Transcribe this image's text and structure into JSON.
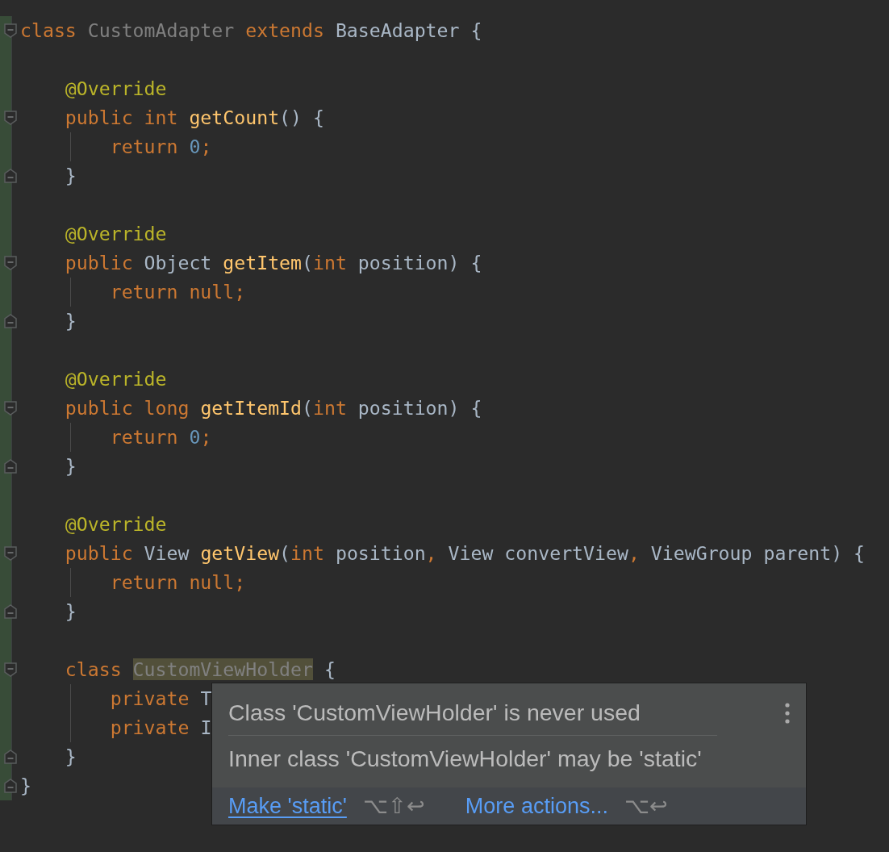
{
  "editor": {
    "lines": [
      {
        "kind": "code",
        "changed": true,
        "fold_start": true,
        "fold_end": false,
        "guide": false,
        "tokens": [
          {
            "kind": "keyword",
            "text": "class "
          },
          {
            "kind": "unused",
            "text": "CustomAdapter "
          },
          {
            "kind": "keyword",
            "text": "extends "
          },
          {
            "kind": "plain",
            "text": "BaseAdapter {"
          }
        ]
      },
      {
        "kind": "blank",
        "changed": true,
        "fold_start": false,
        "fold_end": false,
        "guide": false
      },
      {
        "kind": "code",
        "changed": true,
        "fold_start": false,
        "fold_end": false,
        "guide": false,
        "tokens": [
          {
            "kind": "annotation",
            "text": "    @Override"
          }
        ]
      },
      {
        "kind": "code",
        "changed": true,
        "fold_start": true,
        "fold_end": false,
        "guide": false,
        "tokens": [
          {
            "kind": "keyword",
            "text": "    public int "
          },
          {
            "kind": "method",
            "text": "getCount"
          },
          {
            "kind": "plain",
            "text": "() {"
          }
        ]
      },
      {
        "kind": "code",
        "changed": true,
        "fold_start": false,
        "fold_end": false,
        "guide": true,
        "tokens": [
          {
            "kind": "keyword",
            "text": "        return "
          },
          {
            "kind": "number",
            "text": "0"
          },
          {
            "kind": "keyword",
            "text": ";"
          }
        ]
      },
      {
        "kind": "code",
        "changed": true,
        "fold_start": false,
        "fold_end": true,
        "guide": false,
        "tokens": [
          {
            "kind": "plain",
            "text": "    }"
          }
        ]
      },
      {
        "kind": "blank",
        "changed": true,
        "fold_start": false,
        "fold_end": false,
        "guide": false
      },
      {
        "kind": "code",
        "changed": true,
        "fold_start": false,
        "fold_end": false,
        "guide": false,
        "tokens": [
          {
            "kind": "annotation",
            "text": "    @Override"
          }
        ]
      },
      {
        "kind": "code",
        "changed": true,
        "fold_start": true,
        "fold_end": false,
        "guide": false,
        "tokens": [
          {
            "kind": "keyword",
            "text": "    public "
          },
          {
            "kind": "plain",
            "text": "Object "
          },
          {
            "kind": "method",
            "text": "getItem"
          },
          {
            "kind": "plain",
            "text": "("
          },
          {
            "kind": "keyword",
            "text": "int "
          },
          {
            "kind": "plain",
            "text": "position) {"
          }
        ]
      },
      {
        "kind": "code",
        "changed": true,
        "fold_start": false,
        "fold_end": false,
        "guide": true,
        "tokens": [
          {
            "kind": "keyword",
            "text": "        return null;"
          }
        ]
      },
      {
        "kind": "code",
        "changed": true,
        "fold_start": false,
        "fold_end": true,
        "guide": false,
        "tokens": [
          {
            "kind": "plain",
            "text": "    }"
          }
        ]
      },
      {
        "kind": "blank",
        "changed": true,
        "fold_start": false,
        "fold_end": false,
        "guide": false
      },
      {
        "kind": "code",
        "changed": true,
        "fold_start": false,
        "fold_end": false,
        "guide": false,
        "tokens": [
          {
            "kind": "annotation",
            "text": "    @Override"
          }
        ]
      },
      {
        "kind": "code",
        "changed": true,
        "fold_start": true,
        "fold_end": false,
        "guide": false,
        "tokens": [
          {
            "kind": "keyword",
            "text": "    public long "
          },
          {
            "kind": "method",
            "text": "getItemId"
          },
          {
            "kind": "plain",
            "text": "("
          },
          {
            "kind": "keyword",
            "text": "int "
          },
          {
            "kind": "plain",
            "text": "position) {"
          }
        ]
      },
      {
        "kind": "code",
        "changed": true,
        "fold_start": false,
        "fold_end": false,
        "guide": true,
        "tokens": [
          {
            "kind": "keyword",
            "text": "        return "
          },
          {
            "kind": "number",
            "text": "0"
          },
          {
            "kind": "keyword",
            "text": ";"
          }
        ]
      },
      {
        "kind": "code",
        "changed": true,
        "fold_start": false,
        "fold_end": true,
        "guide": false,
        "tokens": [
          {
            "kind": "plain",
            "text": "    }"
          }
        ]
      },
      {
        "kind": "blank",
        "changed": true,
        "fold_start": false,
        "fold_end": false,
        "guide": false
      },
      {
        "kind": "code",
        "changed": true,
        "fold_start": false,
        "fold_end": false,
        "guide": false,
        "tokens": [
          {
            "kind": "annotation",
            "text": "    @Override"
          }
        ]
      },
      {
        "kind": "code",
        "changed": true,
        "fold_start": true,
        "fold_end": false,
        "guide": false,
        "tokens": [
          {
            "kind": "keyword",
            "text": "    public "
          },
          {
            "kind": "plain",
            "text": "View "
          },
          {
            "kind": "method",
            "text": "getView"
          },
          {
            "kind": "plain",
            "text": "("
          },
          {
            "kind": "keyword",
            "text": "int "
          },
          {
            "kind": "plain",
            "text": "position"
          },
          {
            "kind": "keyword",
            "text": ", "
          },
          {
            "kind": "plain",
            "text": "View convertView"
          },
          {
            "kind": "keyword",
            "text": ", "
          },
          {
            "kind": "plain",
            "text": "ViewGroup parent) {"
          }
        ]
      },
      {
        "kind": "code",
        "changed": true,
        "fold_start": false,
        "fold_end": false,
        "guide": true,
        "tokens": [
          {
            "kind": "keyword",
            "text": "        return null;"
          }
        ]
      },
      {
        "kind": "code",
        "changed": true,
        "fold_start": false,
        "fold_end": true,
        "guide": false,
        "tokens": [
          {
            "kind": "plain",
            "text": "    }"
          }
        ]
      },
      {
        "kind": "blank",
        "changed": true,
        "fold_start": false,
        "fold_end": false,
        "guide": false
      },
      {
        "kind": "code",
        "changed": true,
        "fold_start": true,
        "fold_end": false,
        "guide": false,
        "tokens": [
          {
            "kind": "keyword",
            "text": "    class "
          },
          {
            "kind": "highlighted",
            "text": "CustomViewHolder"
          },
          {
            "kind": "plain",
            "text": " {"
          }
        ]
      },
      {
        "kind": "code",
        "changed": true,
        "fold_start": false,
        "fold_end": false,
        "guide": true,
        "tokens": [
          {
            "kind": "keyword",
            "text": "        private "
          },
          {
            "kind": "plain",
            "text": "T"
          }
        ]
      },
      {
        "kind": "code",
        "changed": true,
        "fold_start": false,
        "fold_end": false,
        "guide": true,
        "tokens": [
          {
            "kind": "keyword",
            "text": "        private "
          },
          {
            "kind": "plain",
            "text": "I"
          }
        ]
      },
      {
        "kind": "code",
        "changed": true,
        "fold_start": false,
        "fold_end": true,
        "guide": false,
        "tokens": [
          {
            "kind": "plain",
            "text": "    }"
          }
        ]
      },
      {
        "kind": "code",
        "changed": true,
        "fold_start": false,
        "fold_end": true,
        "guide": false,
        "tokens": [
          {
            "kind": "plain",
            "text": "}"
          }
        ]
      }
    ]
  },
  "popup": {
    "messages": [
      "Class 'CustomViewHolder' is never used",
      "Inner class 'CustomViewHolder' may be 'static'"
    ],
    "actions": [
      {
        "label": "Make 'static'",
        "shortcut": "⌥⇧↩",
        "selected": true
      },
      {
        "label": "More actions...",
        "shortcut": "⌥↩",
        "selected": false
      }
    ]
  }
}
